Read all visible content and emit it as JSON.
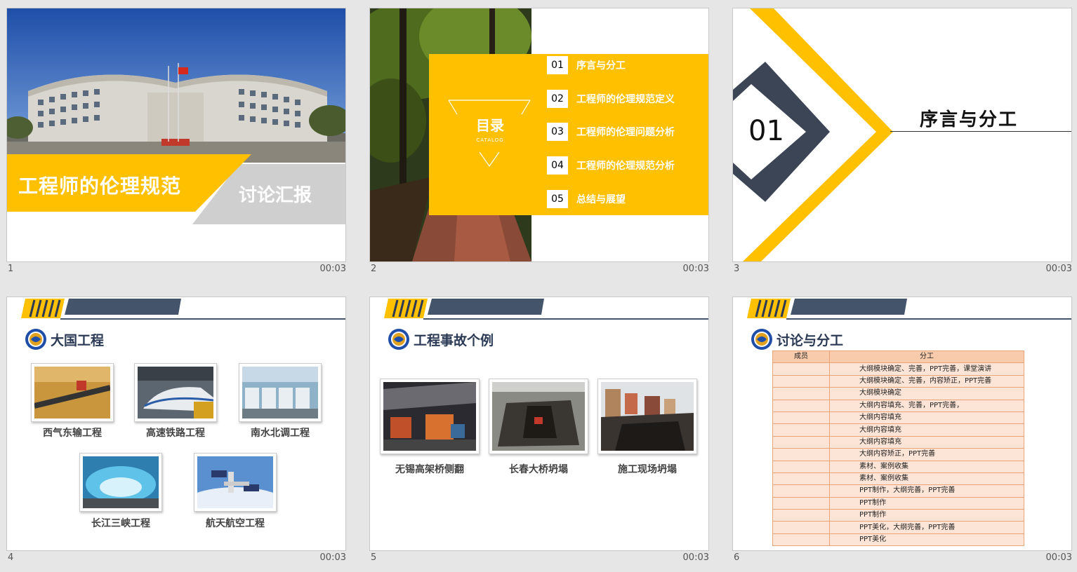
{
  "slides": [
    {
      "number": "1",
      "duration": "00:03",
      "title": "工程师的伦理规范",
      "subtitle": "讨论汇报"
    },
    {
      "number": "2",
      "duration": "00:03",
      "catalog_title": "目录",
      "catalog_en": "CATALOG",
      "items": [
        {
          "num": "01",
          "label": "序言与分工"
        },
        {
          "num": "02",
          "label": "工程师的伦理规范定义"
        },
        {
          "num": "03",
          "label": "工程师的伦理问题分析"
        },
        {
          "num": "04",
          "label": "工程师的伦理规范分析"
        },
        {
          "num": "05",
          "label": "总结与展望"
        }
      ]
    },
    {
      "number": "3",
      "duration": "00:03",
      "section_num": "01",
      "section_title": "序言与分工"
    },
    {
      "number": "4",
      "duration": "00:03",
      "section_title": "大国工程",
      "pictures": [
        "西气东输工程",
        "高速铁路工程",
        "南水北调工程",
        "长江三峡工程",
        "航天航空工程"
      ]
    },
    {
      "number": "5",
      "duration": "00:03",
      "section_title": "工程事故个例",
      "pictures": [
        "无锡高架桥侧翻",
        "长春大桥坍塌",
        "施工现场坍塌"
      ]
    },
    {
      "number": "6",
      "duration": "00:03",
      "section_title": "讨论与分工",
      "table": {
        "headers": [
          "成员",
          "分工"
        ],
        "rows": [
          "大纲模块确定、完善，PPT完善，课堂演讲",
          "大纲模块确定、完善，内容矫正，PPT完善",
          "大纲模块确定",
          "大纲内容填充、完善，PPT完善，",
          "大纲内容填充",
          "大纲内容填充",
          "大纲内容填充",
          "大纲内容矫正，PPT完善",
          "素材、案例收集",
          "素材、案例收集",
          "PPT制作，大纲完善，PPT完善",
          "PPT制作",
          "PPT制作",
          "PPT美化，大纲完善，PPT完善",
          "PPT美化"
        ]
      }
    }
  ],
  "colors": {
    "accent": "#ffc000",
    "navy": "#44546a",
    "header_dark": "#2b3a55"
  }
}
